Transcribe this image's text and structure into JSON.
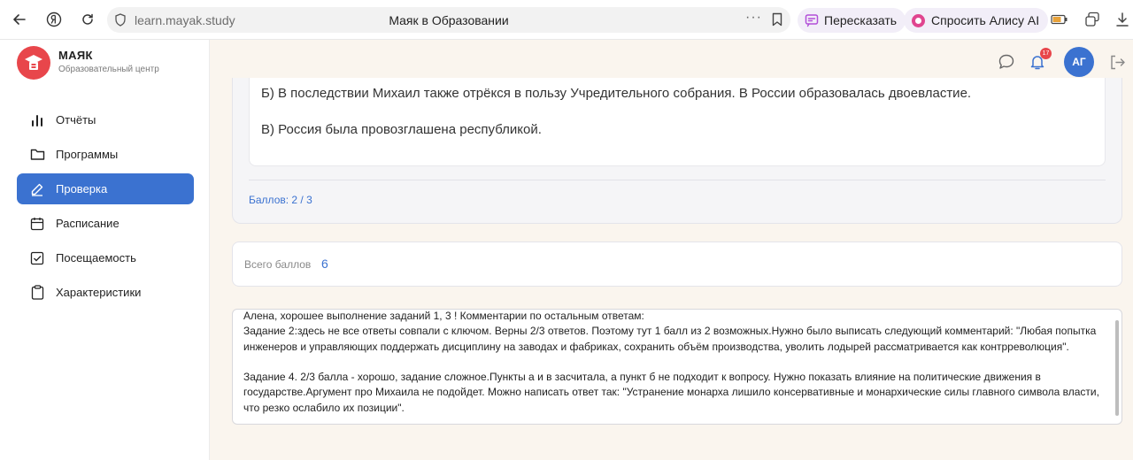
{
  "browser": {
    "url": "learn.mayak.study",
    "page_title": "Маяк в Образовании",
    "retell_label": "Пересказать",
    "ask_alice_label": "Спросить Алису AI",
    "menu_dots": "···"
  },
  "sidebar": {
    "brand": "МАЯК",
    "brand_sub": "Образовательный центр",
    "items": [
      {
        "label": "Отчёты",
        "icon": "bar-chart-icon"
      },
      {
        "label": "Программы",
        "icon": "folder-icon"
      },
      {
        "label": "Проверка",
        "icon": "pencil-icon",
        "active": true
      },
      {
        "label": "Расписание",
        "icon": "calendar-icon"
      },
      {
        "label": "Посещаемость",
        "icon": "checkbox-icon"
      },
      {
        "label": "Характеристики",
        "icon": "clipboard-icon"
      }
    ]
  },
  "header": {
    "notifications_count": "17",
    "avatar_initials": "АГ"
  },
  "task": {
    "answers": [
      "Б) В последствии Михаил также отрёкся в пользу Учредительного собрания. В России образовалась двоевластие.",
      "В) Россия была провозглашена республикой."
    ],
    "score": "Баллов: 2 / 3"
  },
  "total": {
    "label": "Всего баллов",
    "value": "6"
  },
  "comment": {
    "text": "Алена, хорошее выполнение заданий 1, 3 ! Комментарии по остальным ответам:\nЗадание 2:здесь не все ответы совпали с ключом. Верны 2/3 ответов. Поэтому тут 1 балл из 2 возможных.Нужно было выписать следующий комментарий: \"Любая попытка инженеров и управляющих поддержать дисциплину на заводах и фабриках, сохранить объём производства, уволить лодырей рассматривается как контрреволюция\".\n\nЗадание 4. 2/3 балла - хорошо, задание сложное.Пункты а и в засчитала, а пункт б не подходит к вопросу. Нужно показать влияние на политические движения в государстве.Аргумент про Михаила не подойдет. Можно написать ответ так: \"Устранение монарха лишило консервативные и монархические силы главного символа власти, что резко ослабило их позиции\"."
  },
  "colors": {
    "accent": "#3b72d0",
    "brand_red": "#e8464b",
    "page_bg": "#faf5ee"
  }
}
